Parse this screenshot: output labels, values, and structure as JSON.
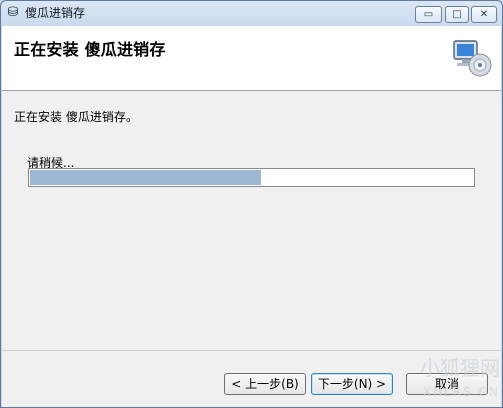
{
  "window": {
    "title": "傻瓜进销存",
    "controls": {
      "minimize": "▭",
      "maximize": "□",
      "close": "✕"
    }
  },
  "header": {
    "title": "正在安装 傻瓜进销存",
    "icon": "installer-computer-icon"
  },
  "content": {
    "message": "正在安装 傻瓜进销存。",
    "waiting": "请稍候...",
    "progress_fraction": 0.52
  },
  "buttons": {
    "back": "< 上一步(B)",
    "next": "下一步(N) >",
    "cancel": "取消"
  },
  "watermark": {
    "title": "小狐狸网",
    "sub": "XHLRS.CN"
  }
}
